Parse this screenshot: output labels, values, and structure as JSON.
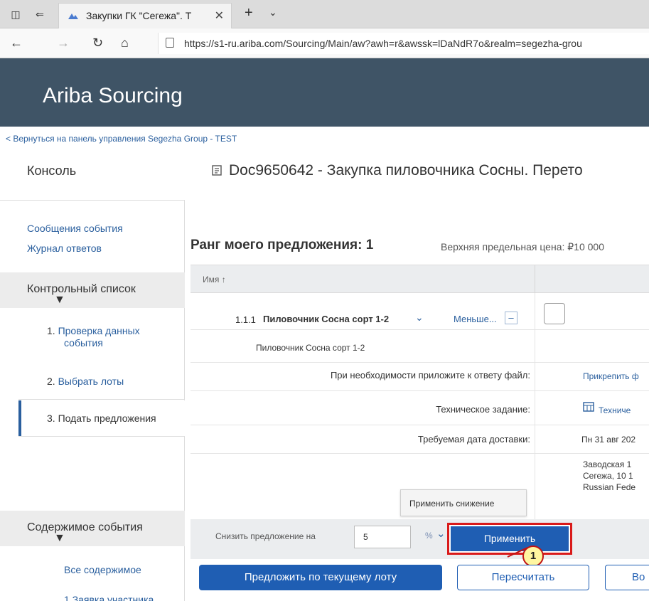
{
  "browser": {
    "tab_title": "Закупки ГК \"Сегежа\". Т",
    "url": "https://s1-ru.ariba.com/Sourcing/Main/aw?awh=r&awssk=lDaNdR7o&realm=segezha-grou"
  },
  "app": {
    "brand": "Ariba Sourcing",
    "back_link": "< Вернуться на панель управления Segezha Group - TEST"
  },
  "sidebar": {
    "console_title": "Консоль",
    "links": [
      "Сообщения события",
      "Журнал ответов"
    ],
    "checklist_header": "Контрольный список",
    "steps": [
      {
        "num": "1.",
        "label": "Проверка данных",
        "label2": "события"
      },
      {
        "num": "2.",
        "label": "Выбрать лоты"
      },
      {
        "num": "3.",
        "label": "Подать предложения"
      }
    ],
    "content_header": "Содержимое события",
    "all_content": "Все содержимое",
    "participant_item": "1  Заявка участника"
  },
  "main": {
    "doc_title": "Doc9650642 - Закупка пиловочника Сосны. Перето",
    "rank_label": "Ранг моего предложения: 1",
    "ceiling_price": "Верхняя предельная цена: ₽10 000",
    "table_header_name": "Имя ↑",
    "item": {
      "number": "1.1.1",
      "name": "Пиловочник Сосна сорт 1-2",
      "less_link": "Меньше...",
      "description": "Пиловочник Сосна сорт 1-2"
    },
    "fields": [
      {
        "label": "При необходимости приложите к ответу файл:",
        "value": "Прикрепить ф"
      },
      {
        "label": "Техническое задание:",
        "value": "Техниче"
      },
      {
        "label": "Требуемая дата доставки:",
        "value": "Пн 31 авг 202"
      }
    ],
    "address_lines": [
      "Заводская 1",
      "Сегежа, 10  1",
      "Russian Fede"
    ]
  },
  "bid": {
    "tooltip": "Применить снижение",
    "reduce_label": "Снизить предложение на",
    "reduce_value": "5",
    "unit": "%",
    "apply_button": "Применить"
  },
  "callout": {
    "number": "1"
  },
  "actions": {
    "submit_lot": "Предложить по текущему лоту",
    "recalculate": "Пересчитать",
    "third": "Во"
  }
}
